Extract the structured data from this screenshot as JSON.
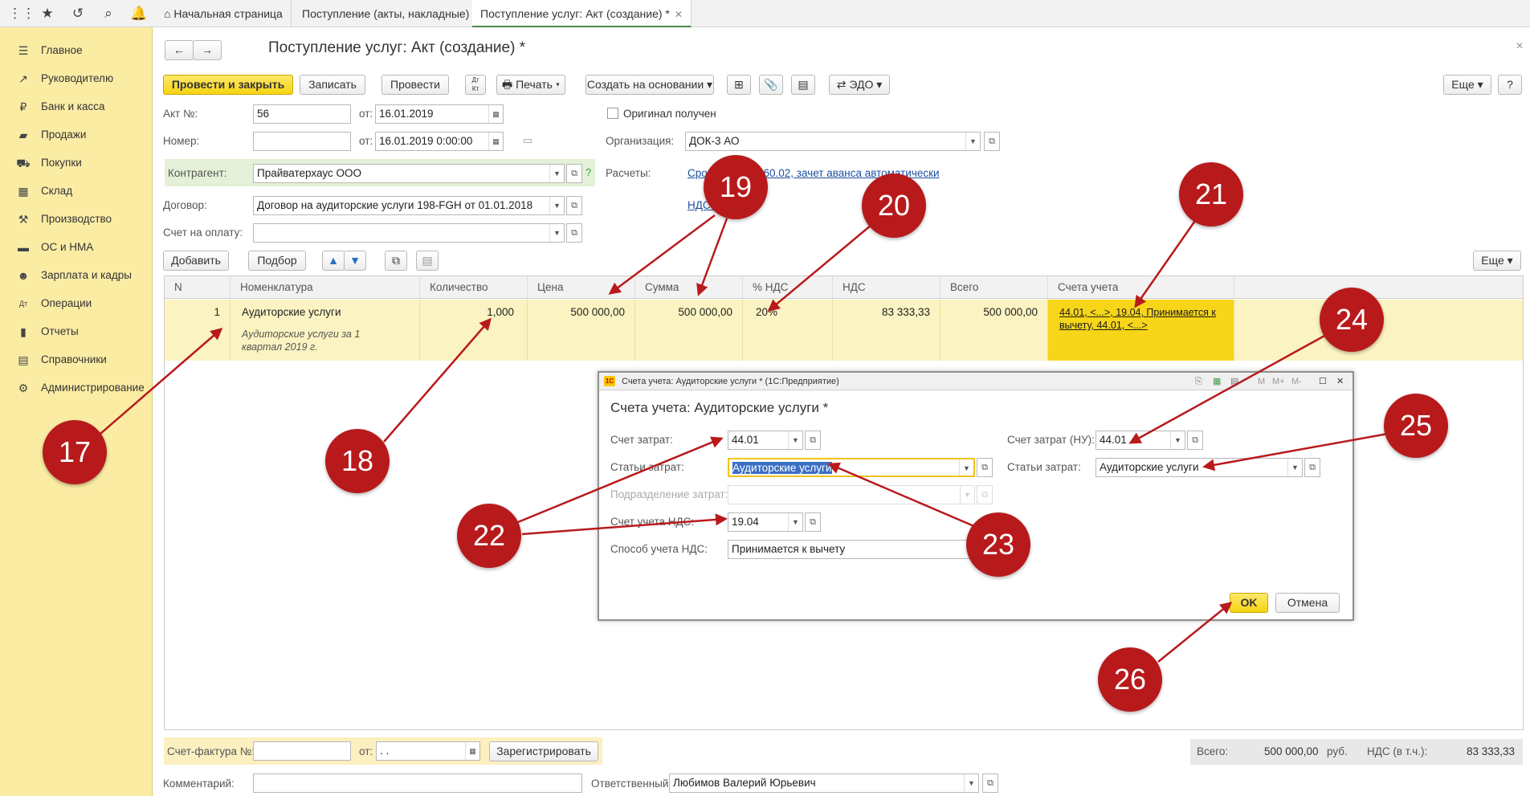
{
  "topbar": {
    "tabs": [
      "Начальная страница",
      "Поступление (акты, накладные)",
      "Поступление услуг: Акт (создание) *"
    ]
  },
  "sidebar": {
    "items": [
      {
        "label": "Главное",
        "icon": "menu-icon"
      },
      {
        "label": "Руководителю",
        "icon": "chart-trend-icon"
      },
      {
        "label": "Банк и касса",
        "icon": "ruble-icon"
      },
      {
        "label": "Продажи",
        "icon": "bag-icon"
      },
      {
        "label": "Покупки",
        "icon": "cart-icon"
      },
      {
        "label": "Склад",
        "icon": "grid-icon"
      },
      {
        "label": "Производство",
        "icon": "factory-icon"
      },
      {
        "label": "ОС и НМА",
        "icon": "truck-icon"
      },
      {
        "label": "Зарплата и кадры",
        "icon": "person-icon"
      },
      {
        "label": "Операции",
        "icon": "dt-kt-icon"
      },
      {
        "label": "Отчеты",
        "icon": "report-icon"
      },
      {
        "label": "Справочники",
        "icon": "book-icon"
      },
      {
        "label": "Администрирование",
        "icon": "gear-icon"
      }
    ]
  },
  "doc": {
    "title": "Поступление услуг: Акт (создание) *",
    "toolbar": {
      "post_close": "Провести и закрыть",
      "save": "Записать",
      "post": "Провести",
      "print": "Печать",
      "create_based": "Создать на основании",
      "edo": "ЭДО",
      "more": "Еще",
      "help": "?"
    },
    "act_no_label": "Акт №:",
    "act_no": "56",
    "from_label": "от:",
    "act_date": "16.01.2019",
    "number_label": "Номер:",
    "number_value": "",
    "number_date": "16.01.2019  0:00:00",
    "original_received": "Оригинал получен",
    "org_label": "Организация:",
    "org_value": "ДОК-3 АО",
    "counterparty_label": "Контрагент:",
    "counterparty_value": "Прайватерхаус ООО",
    "counterparty_help": "?",
    "settlements_label": "Расчеты:",
    "settlements_link": "Сроки... 60.01, 60.02, зачет аванса автоматически",
    "contract_label": "Договор:",
    "contract_value": "Договор на аудиторские услуги 198-FGH от 01.01.2018",
    "vat_link": "НДС ...",
    "invoice_pay_label": "Счет на оплату:",
    "invoice_pay_value": "",
    "add": "Добавить",
    "pick": "Подбор",
    "more2": "Еще"
  },
  "table": {
    "headers": [
      "N",
      "Номенклатура",
      "Количество",
      "Цена",
      "Сумма",
      "% НДС",
      "НДС",
      "Всего",
      "Счета учета"
    ],
    "rows": [
      {
        "n": "1",
        "nomenclature": "Аудиторские услуги",
        "content": "Аудиторские услуги за 1 квартал 2019 г.",
        "qty": "1,000",
        "price": "500 000,00",
        "sum": "500 000,00",
        "vat_rate": "20%",
        "vat": "83 333,33",
        "total": "500 000,00",
        "accounts": "44.01, <...>, 19.04, Принимается к вычету, 44.01, <...>"
      }
    ]
  },
  "dialog": {
    "window_title": "Счета учета: Аудиторские услуги * (1С:Предприятие)",
    "title": "Счета учета: Аудиторские услуги *",
    "cost_account_label": "Счет затрат:",
    "cost_account": "44.01",
    "cost_items_label": "Статьи затрат:",
    "cost_items": "Аудиторские услуги",
    "division_label": "Подразделение затрат:",
    "division": "",
    "vat_account_label": "Счет учета НДС:",
    "vat_account": "19.04",
    "vat_method_label": "Способ учета НДС:",
    "vat_method": "Принимается к вычету",
    "cost_account_nu_label": "Счет затрат (НУ):",
    "cost_account_nu": "44.01",
    "cost_items_nu_label": "Статьи затрат:",
    "cost_items_nu": "Аудиторские услуги",
    "ok": "OK",
    "cancel": "Отмена",
    "tb_m": "M",
    "tb_mplus": "M+",
    "tb_mminus": "M-"
  },
  "footer": {
    "invoice_label": "Счет-фактура №:",
    "invoice_no": "",
    "from_label": "от:",
    "invoice_date": " .  .",
    "register": "Зарегистрировать",
    "comment_label": "Комментарий:",
    "comment": "",
    "responsible_label": "Ответственный:",
    "responsible": "Любимов Валерий Юрьевич",
    "total_label": "Всего:",
    "total": "500 000,00",
    "currency": "руб.",
    "vat_incl_label": "НДС (в т.ч.):",
    "vat_incl": "83 333,33"
  },
  "callouts": [
    "17",
    "18",
    "19",
    "20",
    "21",
    "22",
    "23",
    "24",
    "25",
    "26"
  ],
  "colors": {
    "callout": "#b81a1c",
    "sidebar": "#fbeca4",
    "primary_button": "#f5d413",
    "row_highlight": "#fbf3c1",
    "accounts_cell": "#f7d61a"
  }
}
